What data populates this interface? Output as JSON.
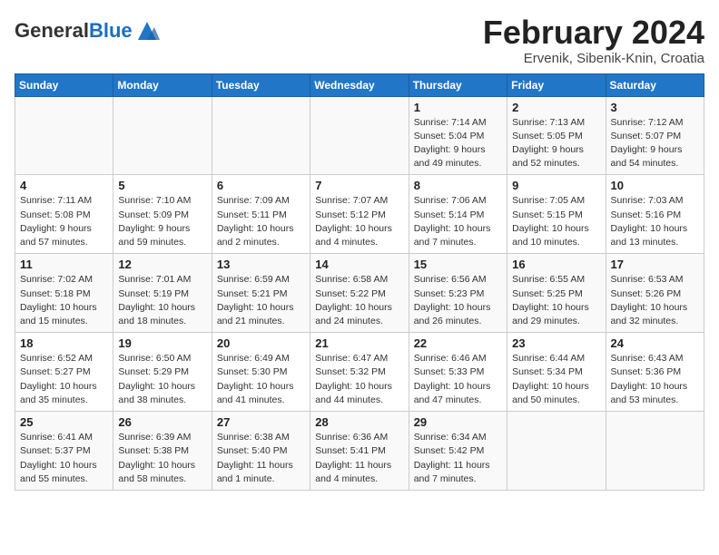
{
  "header": {
    "logo_general": "General",
    "logo_blue": "Blue",
    "month_title": "February 2024",
    "location": "Ervenik, Sibenik-Knin, Croatia"
  },
  "weekdays": [
    "Sunday",
    "Monday",
    "Tuesday",
    "Wednesday",
    "Thursday",
    "Friday",
    "Saturday"
  ],
  "weeks": [
    [
      {
        "day": "",
        "detail": ""
      },
      {
        "day": "",
        "detail": ""
      },
      {
        "day": "",
        "detail": ""
      },
      {
        "day": "",
        "detail": ""
      },
      {
        "day": "1",
        "detail": "Sunrise: 7:14 AM\nSunset: 5:04 PM\nDaylight: 9 hours\nand 49 minutes."
      },
      {
        "day": "2",
        "detail": "Sunrise: 7:13 AM\nSunset: 5:05 PM\nDaylight: 9 hours\nand 52 minutes."
      },
      {
        "day": "3",
        "detail": "Sunrise: 7:12 AM\nSunset: 5:07 PM\nDaylight: 9 hours\nand 54 minutes."
      }
    ],
    [
      {
        "day": "4",
        "detail": "Sunrise: 7:11 AM\nSunset: 5:08 PM\nDaylight: 9 hours\nand 57 minutes."
      },
      {
        "day": "5",
        "detail": "Sunrise: 7:10 AM\nSunset: 5:09 PM\nDaylight: 9 hours\nand 59 minutes."
      },
      {
        "day": "6",
        "detail": "Sunrise: 7:09 AM\nSunset: 5:11 PM\nDaylight: 10 hours\nand 2 minutes."
      },
      {
        "day": "7",
        "detail": "Sunrise: 7:07 AM\nSunset: 5:12 PM\nDaylight: 10 hours\nand 4 minutes."
      },
      {
        "day": "8",
        "detail": "Sunrise: 7:06 AM\nSunset: 5:14 PM\nDaylight: 10 hours\nand 7 minutes."
      },
      {
        "day": "9",
        "detail": "Sunrise: 7:05 AM\nSunset: 5:15 PM\nDaylight: 10 hours\nand 10 minutes."
      },
      {
        "day": "10",
        "detail": "Sunrise: 7:03 AM\nSunset: 5:16 PM\nDaylight: 10 hours\nand 13 minutes."
      }
    ],
    [
      {
        "day": "11",
        "detail": "Sunrise: 7:02 AM\nSunset: 5:18 PM\nDaylight: 10 hours\nand 15 minutes."
      },
      {
        "day": "12",
        "detail": "Sunrise: 7:01 AM\nSunset: 5:19 PM\nDaylight: 10 hours\nand 18 minutes."
      },
      {
        "day": "13",
        "detail": "Sunrise: 6:59 AM\nSunset: 5:21 PM\nDaylight: 10 hours\nand 21 minutes."
      },
      {
        "day": "14",
        "detail": "Sunrise: 6:58 AM\nSunset: 5:22 PM\nDaylight: 10 hours\nand 24 minutes."
      },
      {
        "day": "15",
        "detail": "Sunrise: 6:56 AM\nSunset: 5:23 PM\nDaylight: 10 hours\nand 26 minutes."
      },
      {
        "day": "16",
        "detail": "Sunrise: 6:55 AM\nSunset: 5:25 PM\nDaylight: 10 hours\nand 29 minutes."
      },
      {
        "day": "17",
        "detail": "Sunrise: 6:53 AM\nSunset: 5:26 PM\nDaylight: 10 hours\nand 32 minutes."
      }
    ],
    [
      {
        "day": "18",
        "detail": "Sunrise: 6:52 AM\nSunset: 5:27 PM\nDaylight: 10 hours\nand 35 minutes."
      },
      {
        "day": "19",
        "detail": "Sunrise: 6:50 AM\nSunset: 5:29 PM\nDaylight: 10 hours\nand 38 minutes."
      },
      {
        "day": "20",
        "detail": "Sunrise: 6:49 AM\nSunset: 5:30 PM\nDaylight: 10 hours\nand 41 minutes."
      },
      {
        "day": "21",
        "detail": "Sunrise: 6:47 AM\nSunset: 5:32 PM\nDaylight: 10 hours\nand 44 minutes."
      },
      {
        "day": "22",
        "detail": "Sunrise: 6:46 AM\nSunset: 5:33 PM\nDaylight: 10 hours\nand 47 minutes."
      },
      {
        "day": "23",
        "detail": "Sunrise: 6:44 AM\nSunset: 5:34 PM\nDaylight: 10 hours\nand 50 minutes."
      },
      {
        "day": "24",
        "detail": "Sunrise: 6:43 AM\nSunset: 5:36 PM\nDaylight: 10 hours\nand 53 minutes."
      }
    ],
    [
      {
        "day": "25",
        "detail": "Sunrise: 6:41 AM\nSunset: 5:37 PM\nDaylight: 10 hours\nand 55 minutes."
      },
      {
        "day": "26",
        "detail": "Sunrise: 6:39 AM\nSunset: 5:38 PM\nDaylight: 10 hours\nand 58 minutes."
      },
      {
        "day": "27",
        "detail": "Sunrise: 6:38 AM\nSunset: 5:40 PM\nDaylight: 11 hours\nand 1 minute."
      },
      {
        "day": "28",
        "detail": "Sunrise: 6:36 AM\nSunset: 5:41 PM\nDaylight: 11 hours\nand 4 minutes."
      },
      {
        "day": "29",
        "detail": "Sunrise: 6:34 AM\nSunset: 5:42 PM\nDaylight: 11 hours\nand 7 minutes."
      },
      {
        "day": "",
        "detail": ""
      },
      {
        "day": "",
        "detail": ""
      }
    ]
  ]
}
